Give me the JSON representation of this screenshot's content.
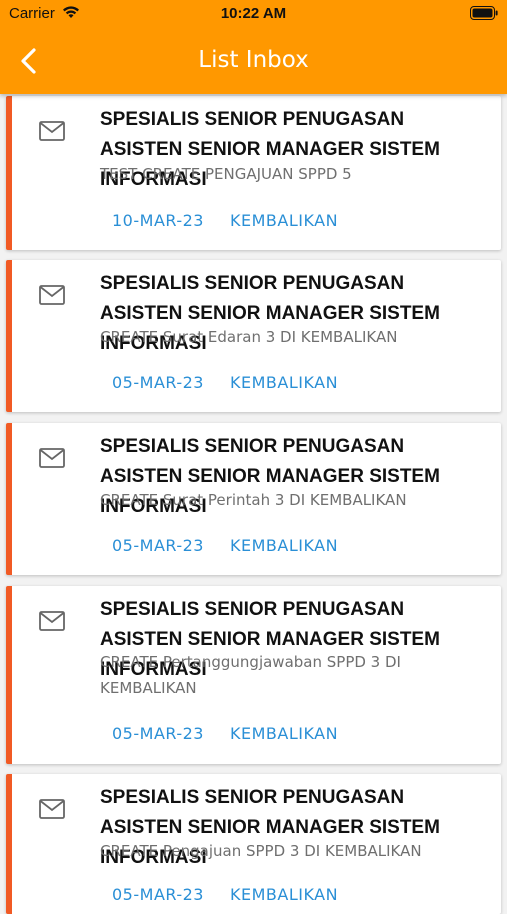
{
  "status_bar": {
    "carrier": "Carrier",
    "time": "10:22 AM"
  },
  "header": {
    "title": "List Inbox",
    "back_icon": "chevron-left-icon"
  },
  "colors": {
    "header": "#ff9800",
    "accent_bar": "#f15a24",
    "link": "#2a8fd6"
  },
  "inbox": [
    {
      "sender": "SPESIALIS SENIOR PENUGASAN ASISTEN SENIOR MANAGER SISTEM INFORMASI",
      "subject": "TEST CREATE PENGAJUAN SPPD 5",
      "date": "10-MAR-23",
      "status": "KEMBALIKAN"
    },
    {
      "sender": "SPESIALIS SENIOR PENUGASAN ASISTEN SENIOR MANAGER SISTEM INFORMASI",
      "subject": "CREATE Surat Edaran 3 DI KEMBALIKAN",
      "date": "05-MAR-23",
      "status": "KEMBALIKAN"
    },
    {
      "sender": "SPESIALIS SENIOR PENUGASAN ASISTEN SENIOR MANAGER SISTEM INFORMASI",
      "subject": "CREATE Surat Perintah 3 DI KEMBALIKAN",
      "date": "05-MAR-23",
      "status": "KEMBALIKAN"
    },
    {
      "sender": "SPESIALIS SENIOR PENUGASAN ASISTEN SENIOR MANAGER SISTEM INFORMASI",
      "subject": "CREATE Pertanggungjawaban SPPD 3 DI KEMBALIKAN",
      "date": "05-MAR-23",
      "status": "KEMBALIKAN"
    },
    {
      "sender": "SPESIALIS SENIOR PENUGASAN ASISTEN SENIOR MANAGER SISTEM INFORMASI",
      "subject": "CREATE Pengajuan SPPD 3 DI KEMBALIKAN",
      "date": "05-MAR-23",
      "status": "KEMBALIKAN"
    }
  ]
}
